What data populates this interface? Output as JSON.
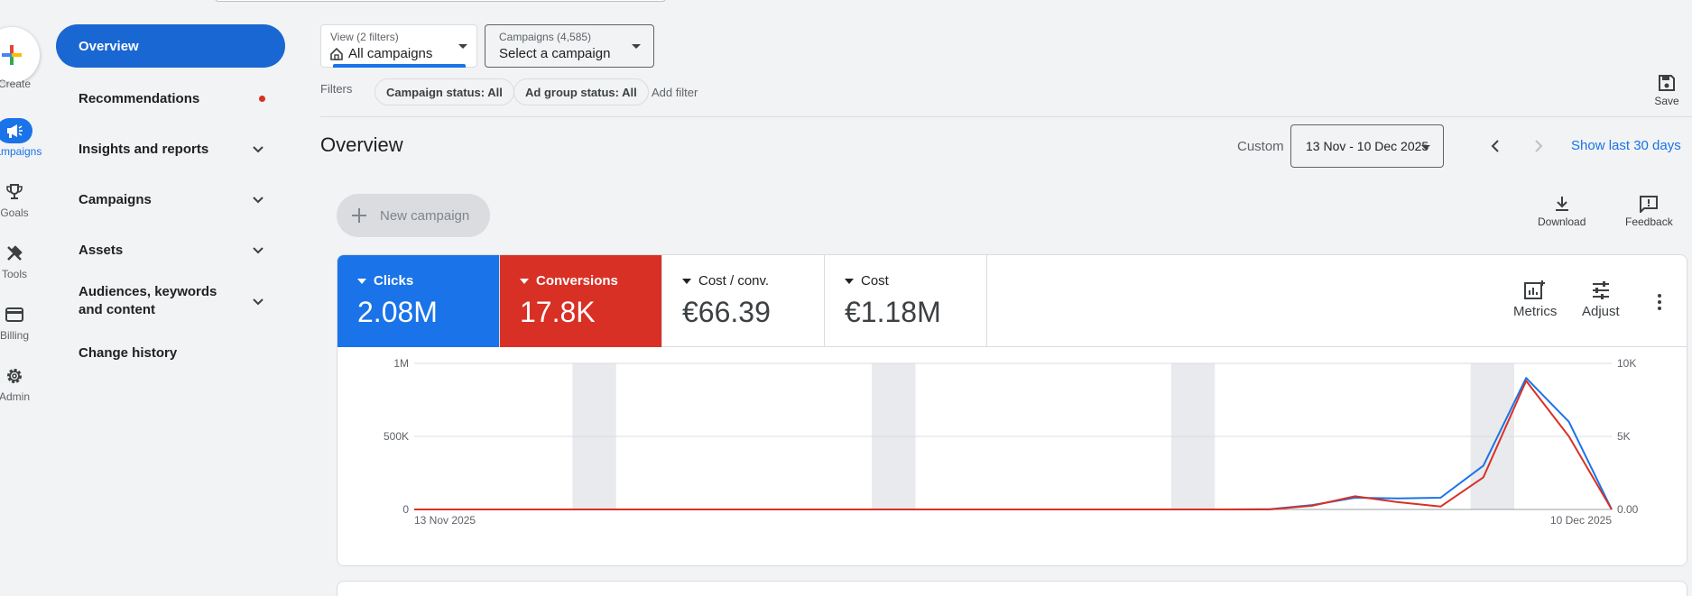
{
  "rail": {
    "create": "Create",
    "items": [
      {
        "label": "Campaigns",
        "icon": "megaphone-icon",
        "active": true
      },
      {
        "label": "Goals",
        "icon": "trophy-icon"
      },
      {
        "label": "Tools",
        "icon": "tools-icon"
      },
      {
        "label": "Billing",
        "icon": "credit-card-icon"
      },
      {
        "label": "Admin",
        "icon": "gear-icon"
      }
    ]
  },
  "nav": {
    "items": [
      {
        "label": "Overview",
        "active": true
      },
      {
        "label": "Recommendations",
        "has_dot": true
      },
      {
        "label": "Insights and reports",
        "expandable": true
      },
      {
        "label": "Campaigns",
        "expandable": true
      },
      {
        "label": "Assets",
        "expandable": true
      },
      {
        "label": "Audiences, keywords and content",
        "expandable": true
      },
      {
        "label": "Change history"
      }
    ]
  },
  "filterbar": {
    "view_small": "View (2 filters)",
    "view_big": "All campaigns",
    "campaigns_small": "Campaigns (4,585)",
    "campaigns_big": "Select a campaign",
    "filters_label": "Filters",
    "chips": [
      "Campaign status: All",
      "Ad group status: All"
    ],
    "add_filter": "Add filter",
    "save": "Save"
  },
  "header": {
    "title": "Overview",
    "custom_label": "Custom",
    "date_range": "13 Nov - 10 Dec 2025",
    "show_last": "Show last 30 days"
  },
  "actions": {
    "new_campaign": "New campaign",
    "download": "Download",
    "feedback": "Feedback"
  },
  "tiles": [
    {
      "label": "Clicks",
      "value": "2.08M",
      "color": "#1a73e8"
    },
    {
      "label": "Conversions",
      "value": "17.8K",
      "color": "#d93025"
    },
    {
      "label": "Cost / conv.",
      "value": "€66.39"
    },
    {
      "label": "Cost",
      "value": "€1.18M"
    }
  ],
  "tile_tools": {
    "metrics": "Metrics",
    "adjust": "Adjust"
  },
  "chart_data": {
    "type": "line",
    "x_start_label": "13 Nov 2025",
    "x_end_label": "10 Dec 2025",
    "left_axis_ticks": [
      "0",
      "500K",
      "1M"
    ],
    "right_axis_ticks": [
      "0.00",
      "5K",
      "10K"
    ],
    "left_ylim": [
      0,
      1000000
    ],
    "right_ylim": [
      0,
      10000
    ],
    "series": [
      {
        "name": "Clicks",
        "axis": "left",
        "color": "#1a73e8",
        "values": [
          0,
          0,
          0,
          0,
          0,
          0,
          0,
          0,
          0,
          0,
          0,
          0,
          0,
          0,
          0,
          0,
          0,
          0,
          0,
          0,
          2000,
          30000,
          80000,
          75000,
          80000,
          300000,
          900000,
          600000,
          0
        ]
      },
      {
        "name": "Conversions",
        "axis": "right",
        "color": "#d93025",
        "values": [
          0,
          0,
          0,
          0,
          0,
          0,
          0,
          0,
          0,
          0,
          0,
          0,
          0,
          0,
          0,
          0,
          0,
          0,
          0,
          0,
          0,
          250,
          900,
          500,
          200,
          2200,
          8800,
          5000,
          0
        ]
      }
    ]
  }
}
